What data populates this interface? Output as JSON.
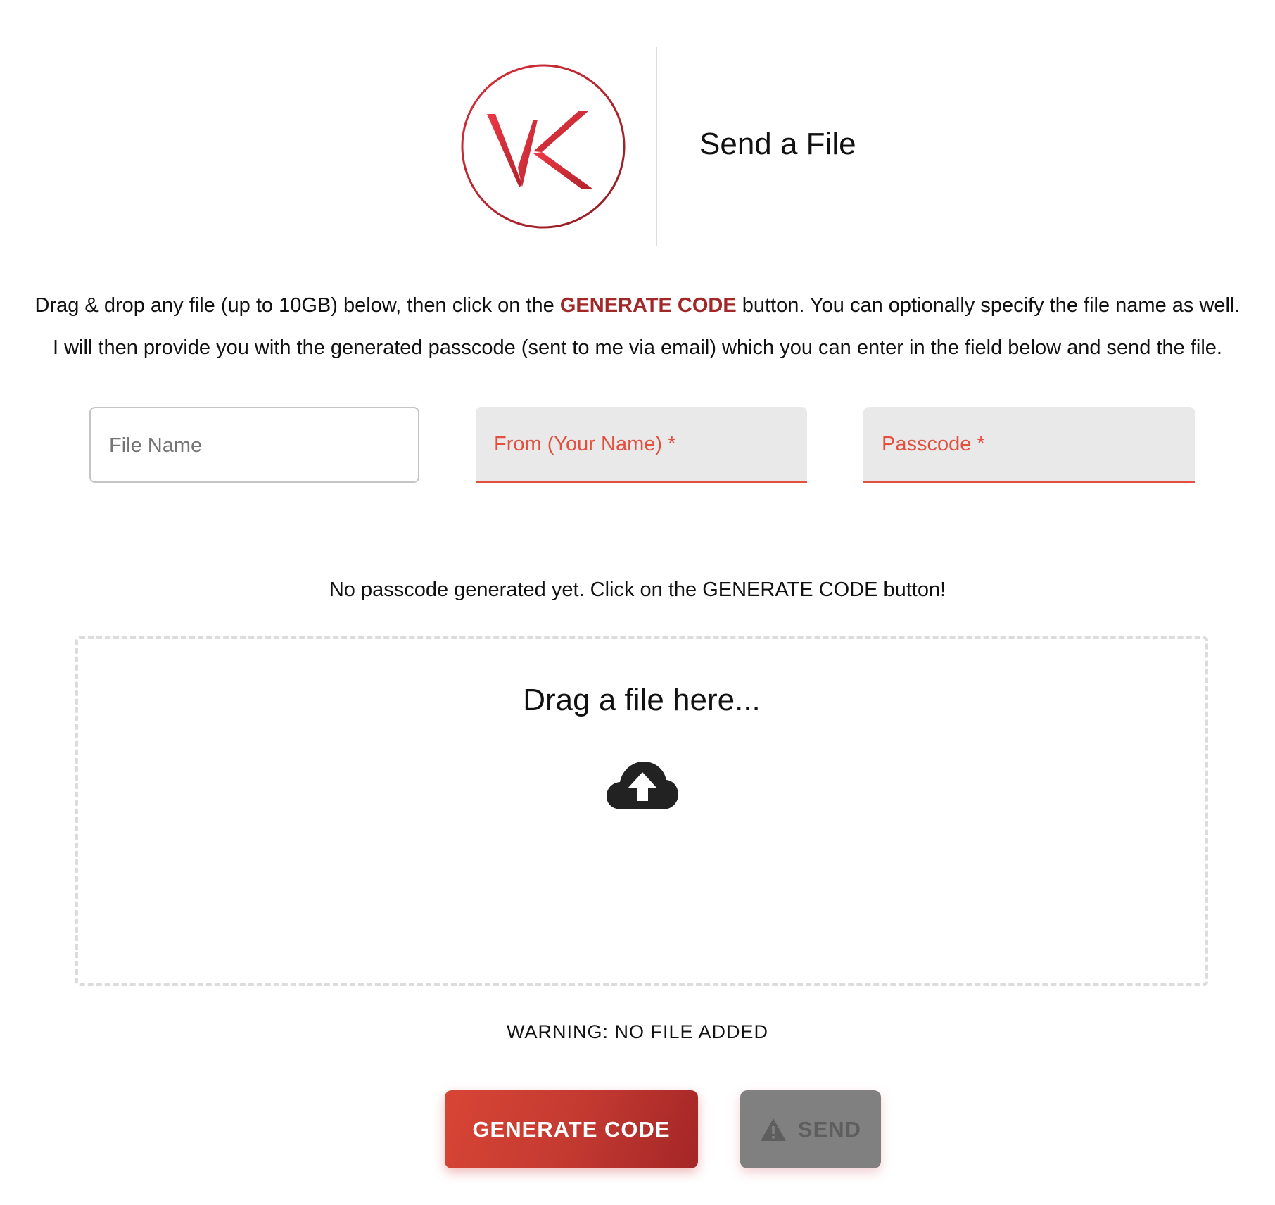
{
  "header": {
    "logo_alt": "VK",
    "title": "Send a File"
  },
  "instructions": {
    "line1_before": "Drag & drop any file (up to 10GB) below, then click on the ",
    "line1_highlight": "GENERATE CODE",
    "line1_after": " button. You can optionally specify the file name as well.",
    "line2": "I will then provide you with the generated passcode (sent to me via email) which you can enter in the field below and send the file."
  },
  "fields": {
    "file_name": {
      "label": "File Name",
      "value": ""
    },
    "from_name": {
      "label": "From (Your Name) *",
      "value": ""
    },
    "passcode": {
      "label": "Passcode *",
      "value": ""
    }
  },
  "status": {
    "message": "No passcode generated yet. Click on the GENERATE CODE button!"
  },
  "dropzone": {
    "prompt": "Drag a file here...",
    "icon": "cloud-upload-icon"
  },
  "warning": {
    "text": "WARNING: NO FILE ADDED"
  },
  "buttons": {
    "generate_label": "GENERATE CODE",
    "send_label": "SEND",
    "send_icon": "warning-icon"
  },
  "colors": {
    "accent": "#e2503f",
    "brand_red": "#a12828",
    "generate_start": "#d84535",
    "generate_end": "#a42627",
    "send_disabled": "#808080"
  }
}
